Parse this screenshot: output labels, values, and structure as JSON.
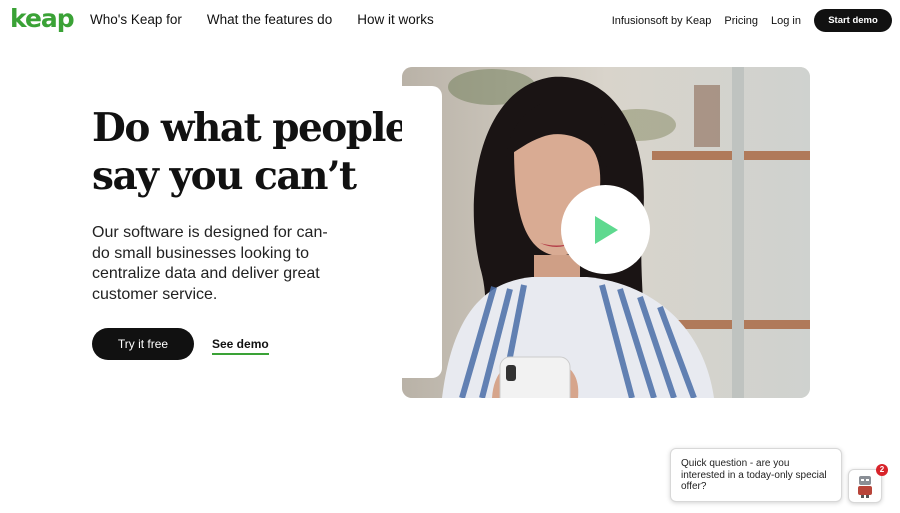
{
  "brand": {
    "logo_text": "keap",
    "accent_color": "#3aa236"
  },
  "nav": {
    "primary": [
      "Who's Keap for",
      "What the features do",
      "How it works"
    ],
    "secondary": [
      "Infusionsoft by Keap",
      "Pricing",
      "Log in"
    ],
    "cta_label": "Start demo"
  },
  "hero": {
    "headline_line1": "Do what people",
    "headline_line2": "say you can’t",
    "subcopy": "Our software is designed for can-do small businesses looking to centralize data and deliver great customer service.",
    "primary_cta": "Try it free",
    "secondary_cta": "See demo"
  },
  "video": {
    "play_icon": "play-icon",
    "play_color": "#5ed98f"
  },
  "chat": {
    "message": "Quick question - are you interested in a today-only special offer?",
    "badge_count": "2",
    "avatar_icon": "robot-avatar-icon"
  }
}
